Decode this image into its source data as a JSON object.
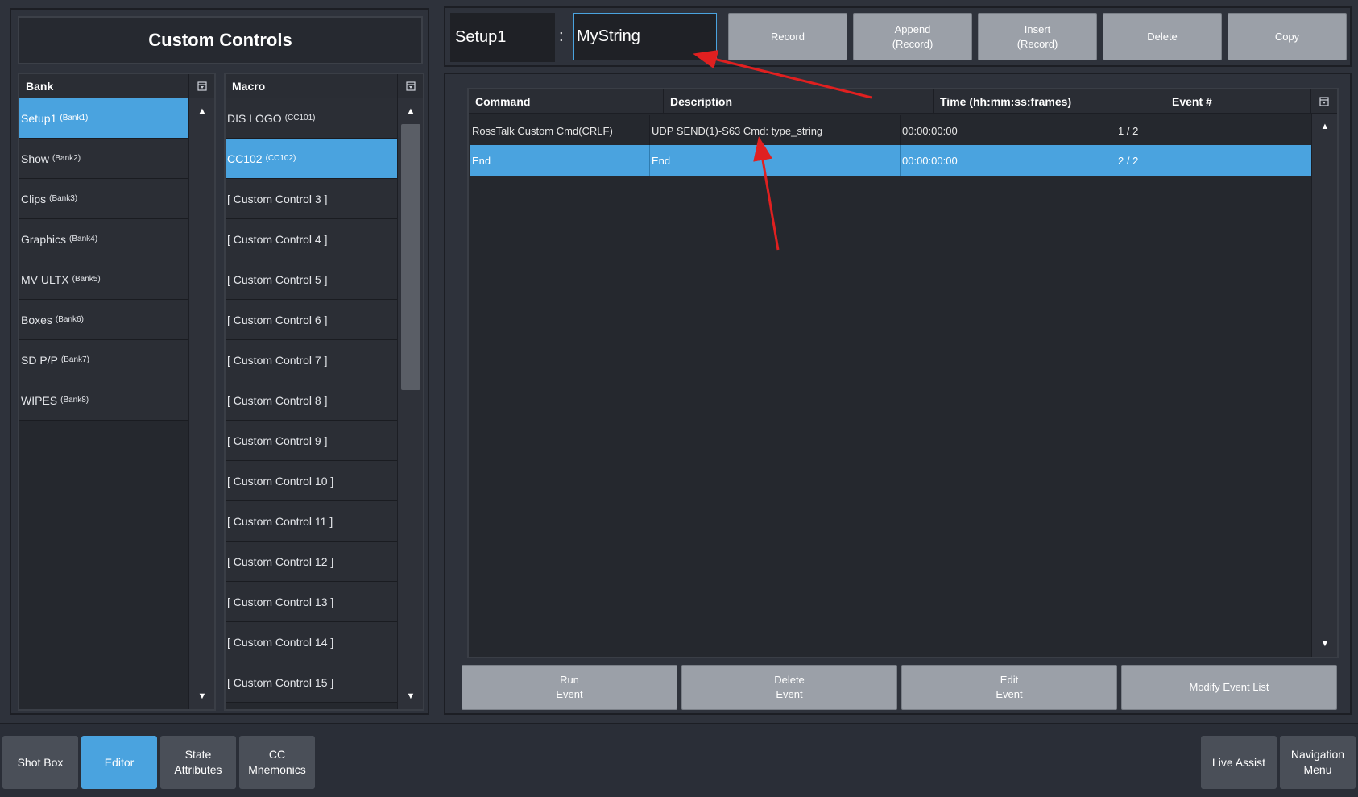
{
  "left_panel": {
    "title": "Custom Controls",
    "bank_header": "Bank",
    "macro_header": "Macro",
    "banks": [
      {
        "name": "Setup1",
        "sub": "(Bank1)",
        "selected": true
      },
      {
        "name": "Show",
        "sub": "(Bank2)",
        "selected": false
      },
      {
        "name": "Clips",
        "sub": "(Bank3)",
        "selected": false
      },
      {
        "name": "Graphics",
        "sub": "(Bank4)",
        "selected": false
      },
      {
        "name": "MV ULTX",
        "sub": "(Bank5)",
        "selected": false
      },
      {
        "name": "Boxes",
        "sub": "(Bank6)",
        "selected": false
      },
      {
        "name": "SD P/P",
        "sub": "(Bank7)",
        "selected": false
      },
      {
        "name": "WIPES",
        "sub": "(Bank8)",
        "selected": false
      }
    ],
    "macros": [
      {
        "name": "DIS LOGO",
        "sub": "(CC101)",
        "selected": false
      },
      {
        "name": "CC102",
        "sub": "(CC102)",
        "selected": true
      },
      {
        "name": "[ Custom Control 3 ]",
        "sub": "",
        "selected": false
      },
      {
        "name": "[ Custom Control 4 ]",
        "sub": "",
        "selected": false
      },
      {
        "name": "[ Custom Control 5 ]",
        "sub": "",
        "selected": false
      },
      {
        "name": "[ Custom Control 6 ]",
        "sub": "",
        "selected": false
      },
      {
        "name": "[ Custom Control 7 ]",
        "sub": "",
        "selected": false
      },
      {
        "name": "[ Custom Control 8 ]",
        "sub": "",
        "selected": false
      },
      {
        "name": "[ Custom Control 9 ]",
        "sub": "",
        "selected": false
      },
      {
        "name": "[ Custom Control 10 ]",
        "sub": "",
        "selected": false
      },
      {
        "name": "[ Custom Control 11 ]",
        "sub": "",
        "selected": false
      },
      {
        "name": "[ Custom Control 12 ]",
        "sub": "",
        "selected": false
      },
      {
        "name": "[ Custom Control 13 ]",
        "sub": "",
        "selected": false
      },
      {
        "name": "[ Custom Control 14 ]",
        "sub": "",
        "selected": false
      },
      {
        "name": "[ Custom Control 15 ]",
        "sub": "",
        "selected": false
      }
    ]
  },
  "top_bar": {
    "bank_name": "Setup1",
    "separator": ":",
    "macro_name_value": "MyString",
    "buttons": [
      "Record",
      "Append\n(Record)",
      "Insert\n(Record)",
      "Delete",
      "Copy"
    ]
  },
  "event_table": {
    "headers": [
      "Command",
      "Description",
      "Time (hh:mm:ss:frames)",
      "Event #"
    ],
    "rows": [
      {
        "command": "RossTalk Custom Cmd(CRLF)",
        "description": "UDP SEND(1)-S63 Cmd: type_string",
        "time": "00:00:00:00",
        "event": "1 / 2",
        "selected": false
      },
      {
        "command": "End",
        "description": "End",
        "time": "00:00:00:00",
        "event": "2 / 2",
        "selected": true
      }
    ]
  },
  "event_buttons": [
    "Run\nEvent",
    "Delete\nEvent",
    "Edit\nEvent",
    "Modify Event List"
  ],
  "bottom_nav": {
    "left": [
      {
        "label": "Shot Box",
        "active": false
      },
      {
        "label": "Editor",
        "active": true
      },
      {
        "label": "State\nAttributes",
        "active": false
      },
      {
        "label": "CC\nMnemonics",
        "active": false
      }
    ],
    "right": [
      {
        "label": "Live Assist",
        "active": false
      },
      {
        "label": "Navigation\nMenu",
        "active": false
      }
    ]
  },
  "icons": {
    "column_config": "column-config-icon",
    "scroll_up": "scroll-up-arrow-icon",
    "scroll_down": "scroll-down-arrow-icon"
  },
  "colors": {
    "accent": "#4aa3df",
    "annotation_arrow": "#e02020",
    "button_gray": "#9ba0a8"
  }
}
